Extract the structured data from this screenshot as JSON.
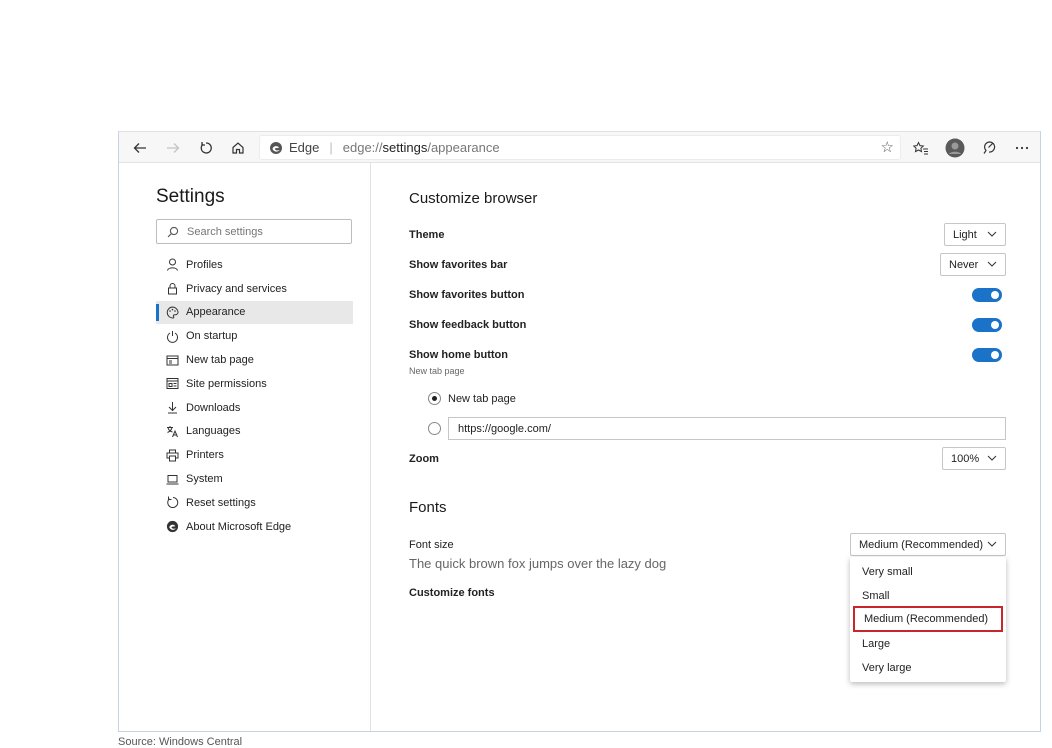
{
  "toolbar": {
    "edge_label": "Edge",
    "url_prefix": "edge://",
    "url_main": "settings",
    "url_suffix": "/appearance"
  },
  "sidebar": {
    "title": "Settings",
    "search_placeholder": "Search settings",
    "items": [
      {
        "label": "Profiles",
        "icon": "person-icon"
      },
      {
        "label": "Privacy and services",
        "icon": "lock-icon"
      },
      {
        "label": "Appearance",
        "icon": "palette-icon",
        "active": true
      },
      {
        "label": "On startup",
        "icon": "power-icon"
      },
      {
        "label": "New tab page",
        "icon": "newtab-icon"
      },
      {
        "label": "Site permissions",
        "icon": "site-permissions-icon"
      },
      {
        "label": "Downloads",
        "icon": "download-icon"
      },
      {
        "label": "Languages",
        "icon": "languages-icon"
      },
      {
        "label": "Printers",
        "icon": "printer-icon"
      },
      {
        "label": "System",
        "icon": "laptop-icon"
      },
      {
        "label": "Reset settings",
        "icon": "reset-icon"
      },
      {
        "label": "About Microsoft Edge",
        "icon": "edge-logo-icon"
      }
    ]
  },
  "customize": {
    "heading": "Customize browser",
    "theme_label": "Theme",
    "theme_value": "Light",
    "fav_bar_label": "Show favorites bar",
    "fav_bar_value": "Never",
    "fav_button_label": "Show favorites button",
    "feedback_button_label": "Show feedback button",
    "home_button_label": "Show home button",
    "home_sub": "New tab page",
    "radio_newtab_label": "New tab page",
    "radio_url_value": "https://google.com/",
    "zoom_label": "Zoom",
    "zoom_value": "100%"
  },
  "fonts": {
    "heading": "Fonts",
    "font_size_label": "Font size",
    "font_size_value": "Medium (Recommended)",
    "sample_text": "The quick brown fox jumps over the lazy dog",
    "customize_label": "Customize fonts",
    "options": [
      "Very small",
      "Small",
      "Medium (Recommended)",
      "Large",
      "Very large"
    ],
    "selected_option": "Medium (Recommended)"
  },
  "colors": {
    "accent": "#1a73c8",
    "highlight": "#c8262d"
  },
  "caption": "Source: Windows Central"
}
